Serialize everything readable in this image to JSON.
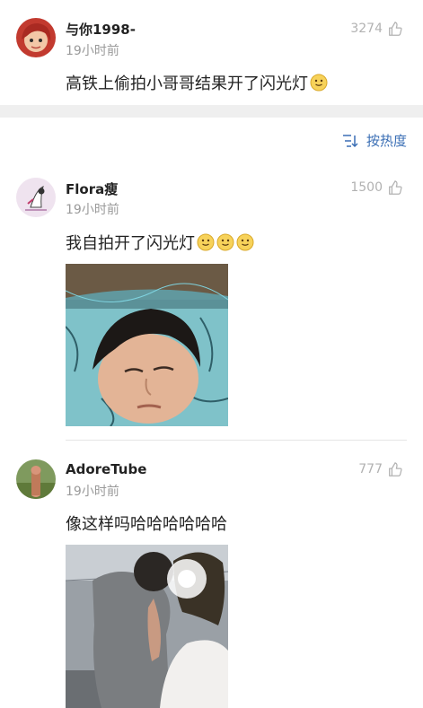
{
  "post": {
    "username": "与你1998-",
    "time": "19小时前",
    "likes": "3274",
    "text": "高铁上偷拍小哥哥结果开了闪光灯"
  },
  "sort": {
    "label": "按热度",
    "icon": "sort-icon"
  },
  "comments": [
    {
      "username": "Flora瘦",
      "time": "19小时前",
      "likes": "1500",
      "text": "我自拍开了闪光灯"
    },
    {
      "username": "AdoreTube",
      "time": "19小时前",
      "likes": "777",
      "text": "像这样吗哈哈哈哈哈哈"
    }
  ],
  "colors": {
    "accent": "#3b6fb5",
    "separator": "#efefef",
    "meta": "#9a9a9a"
  }
}
